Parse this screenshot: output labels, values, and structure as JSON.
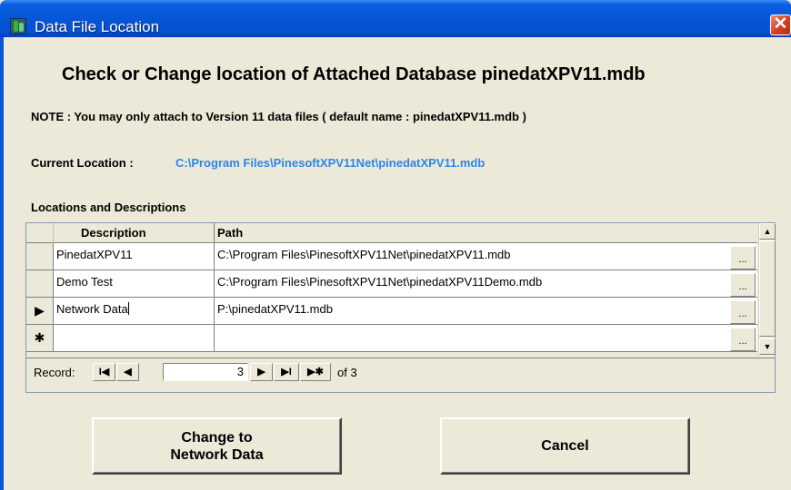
{
  "window": {
    "title": "Data File Location",
    "close_glyph": "✕"
  },
  "heading": "Check or Change location of Attached Database pinedatXPV11.mdb",
  "note": "NOTE : You may only attach to Version 11 data files   ( default name  :  pinedatXPV11.mdb )",
  "current_location": {
    "label": "Current Location :",
    "value": "C:\\Program Files\\PinesoftXPV11Net\\pinedatXPV11.mdb"
  },
  "locations": {
    "label": "Locations and Descriptions",
    "columns": [
      "Description",
      "Path"
    ],
    "rows": [
      {
        "description": "PinedatXPV11",
        "path": "C:\\Program Files\\PinesoftXPV11Net\\pinedatXPV11.mdb",
        "selector": "",
        "browse": "..."
      },
      {
        "description": "Demo Test",
        "path": "C:\\Program Files\\PinesoftXPV11Net\\pinedatXPV11Demo.mdb",
        "selector": "",
        "browse": "..."
      },
      {
        "description": "Network Data",
        "path": "P:\\pinedatXPV11.mdb",
        "selector": "▶",
        "browse": "..."
      },
      {
        "description": "",
        "path": "",
        "selector": "✱",
        "browse": "..."
      }
    ]
  },
  "navigation": {
    "label": "Record:",
    "first": "I◀",
    "prev": "◀",
    "current": "3",
    "next": "▶",
    "last": "▶I",
    "new": "▶✱",
    "of_text": "of 3"
  },
  "scrollbar": {
    "up": "▲",
    "down": "▼"
  },
  "buttons": {
    "change_line1": "Change to",
    "change_line2": "Network Data",
    "cancel": "Cancel"
  }
}
